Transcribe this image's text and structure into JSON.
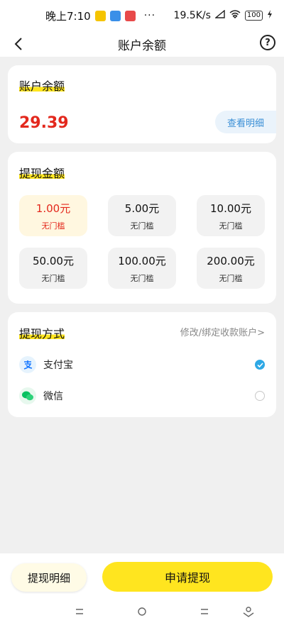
{
  "status_bar": {
    "time": "晚上7:10",
    "dots": "···",
    "speed": "19.5K/s",
    "battery": "100"
  },
  "header": {
    "title": "账户余额",
    "help": "?"
  },
  "balance": {
    "title": "账户余额",
    "amount": "29.39",
    "detail_label": "查看明细"
  },
  "withdraw": {
    "title": "提现金额",
    "options": [
      {
        "value": "1.00元",
        "note": "无门槛",
        "selected": true
      },
      {
        "value": "5.00元",
        "note": "无门槛",
        "selected": false
      },
      {
        "value": "10.00元",
        "note": "无门槛",
        "selected": false
      },
      {
        "value": "50.00元",
        "note": "无门槛",
        "selected": false
      },
      {
        "value": "100.00元",
        "note": "无门槛",
        "selected": false
      },
      {
        "value": "200.00元",
        "note": "无门槛",
        "selected": false
      }
    ]
  },
  "method": {
    "title": "提现方式",
    "modify_label": "修改/绑定收款账户>",
    "options": [
      {
        "label": "支付宝",
        "icon": "alipay-icon",
        "selected": true
      },
      {
        "label": "微信",
        "icon": "wechat-icon",
        "selected": false
      }
    ]
  },
  "footer": {
    "detail_label": "提现明细",
    "apply_label": "申请提现"
  },
  "colors": {
    "accent": "#ffe51f",
    "amount_red": "#e3281d",
    "link_blue": "#3a8fd6",
    "check_blue": "#2ea8e5"
  }
}
